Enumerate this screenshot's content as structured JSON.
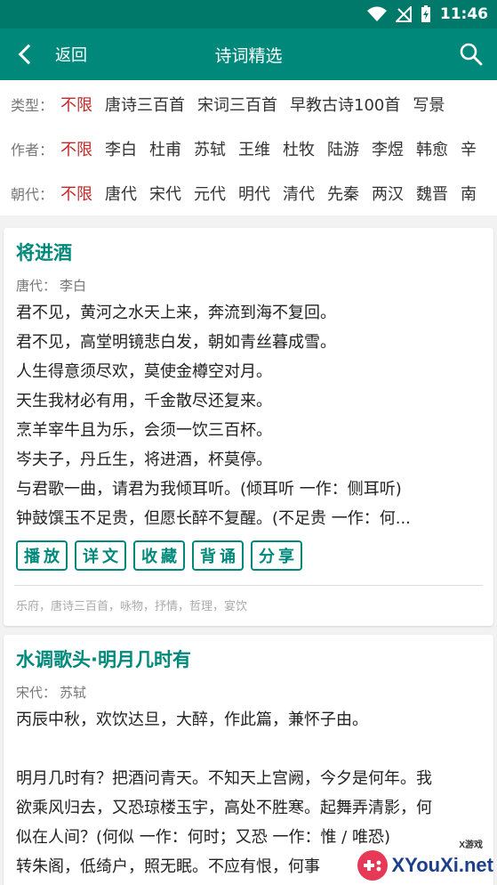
{
  "status_bar": {
    "time": "11:46"
  },
  "app_bar": {
    "back_label": "返回",
    "title": "诗词精选"
  },
  "filters": {
    "type": {
      "label": "类型：",
      "items": [
        "不限",
        "唐诗三百首",
        "宋词三百首",
        "早教古诗100首",
        "写景"
      ]
    },
    "author": {
      "label": "作者：",
      "items": [
        "不限",
        "李白",
        "杜甫",
        "苏轼",
        "王维",
        "杜牧",
        "陆游",
        "李煜",
        "韩愈",
        "辛"
      ]
    },
    "dynasty": {
      "label": "朝代：",
      "items": [
        "不限",
        "唐代",
        "宋代",
        "元代",
        "明代",
        "清代",
        "先秦",
        "两汉",
        "魏晋",
        "南"
      ]
    },
    "active_color": "#c62828"
  },
  "poems": [
    {
      "title": "将进酒",
      "dynasty": "唐代：",
      "author": "李白",
      "lines": [
        "君不见，黄河之水天上来，奔流到海不复回。",
        "君不见，高堂明镜悲白发，朝如青丝暮成雪。",
        "人生得意须尽欢，莫使金樽空对月。",
        "天生我材必有用，千金散尽还复来。",
        "烹羊宰牛且为乐，会须一饮三百杯。",
        "岑夫子，丹丘生，将进酒，杯莫停。",
        "与君歌一曲，请君为我倾耳听。(倾耳听 一作：侧耳听)",
        "钟鼓馔玉不足贵，但愿长醉不复醒。(不足贵 一作：何..."
      ],
      "actions": [
        "播放",
        "详文",
        "收藏",
        "背诵",
        "分享"
      ],
      "tags": "乐府，唐诗三百首，咏物，抒情，哲理，宴饮"
    },
    {
      "title": "水调歌头·明月几时有",
      "dynasty": "宋代：",
      "author": "苏轼",
      "lines": [
        "丙辰中秋，欢饮达旦，大醉，作此篇，兼怀子由。",
        "",
        "明月几时有？把酒问青天。不知天上宫阙，今夕是何年。我",
        "欲乘风归去，又恐琼楼玉宇，高处不胜寒。起舞弄清影，何",
        "似在人间？(何似 一作：何时；又恐 一作：惟 / 唯恐)",
        "转朱阁，低绮户，照无眠。不应有恨，何事"
      ]
    }
  ],
  "watermark": {
    "text": "XYouXi.net",
    "small": "X游戏"
  },
  "theme": {
    "primary": "#00897b",
    "status": "#00796b"
  }
}
